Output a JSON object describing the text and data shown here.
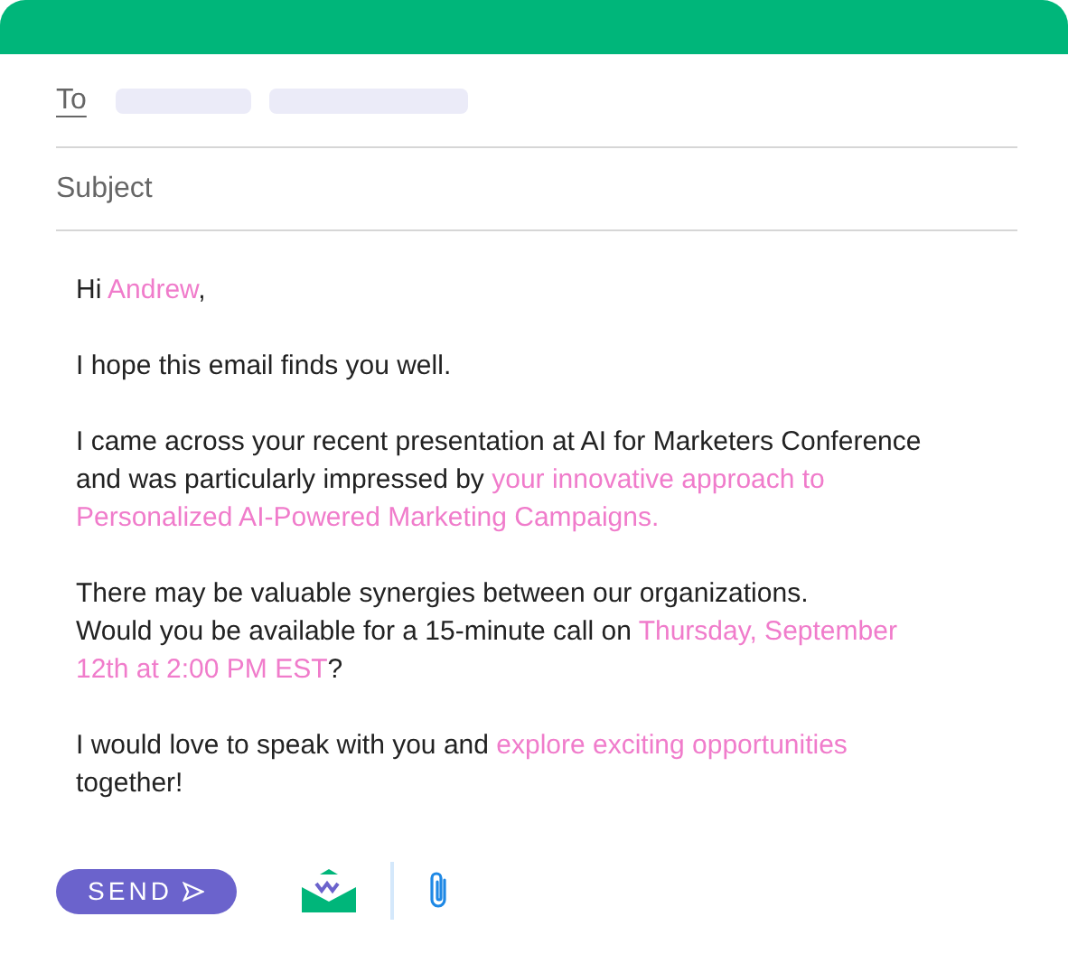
{
  "to": {
    "label": "To"
  },
  "subject": {
    "placeholder": "Subject"
  },
  "body": [
    [
      {
        "text": "Hi ",
        "highlight": false
      },
      {
        "text": "Andrew",
        "highlight": true
      },
      {
        "text": ",",
        "highlight": false
      }
    ],
    [
      {
        "text": "I hope this email finds you well.",
        "highlight": false
      }
    ],
    [
      {
        "text": "I came across your recent presentation at AI for Marketers Conference and was particularly impressed by ",
        "highlight": false
      },
      {
        "text": "your innovative approach to Personalized AI-Powered Marketing Campaigns.",
        "highlight": true
      }
    ],
    [
      {
        "text": "There may be valuable synergies between our organizations.\nWould you be available for a 15-minute call on ",
        "highlight": false
      },
      {
        "text": "Thursday, September 12th at 2:00 PM EST",
        "highlight": true
      },
      {
        "text": "?",
        "highlight": false
      }
    ],
    [
      {
        "text": "I would love to speak with you and ",
        "highlight": false
      },
      {
        "text": "explore exciting opportunities",
        "highlight": true
      },
      {
        "text": " together!",
        "highlight": false
      }
    ]
  ],
  "send_button": "SEND"
}
